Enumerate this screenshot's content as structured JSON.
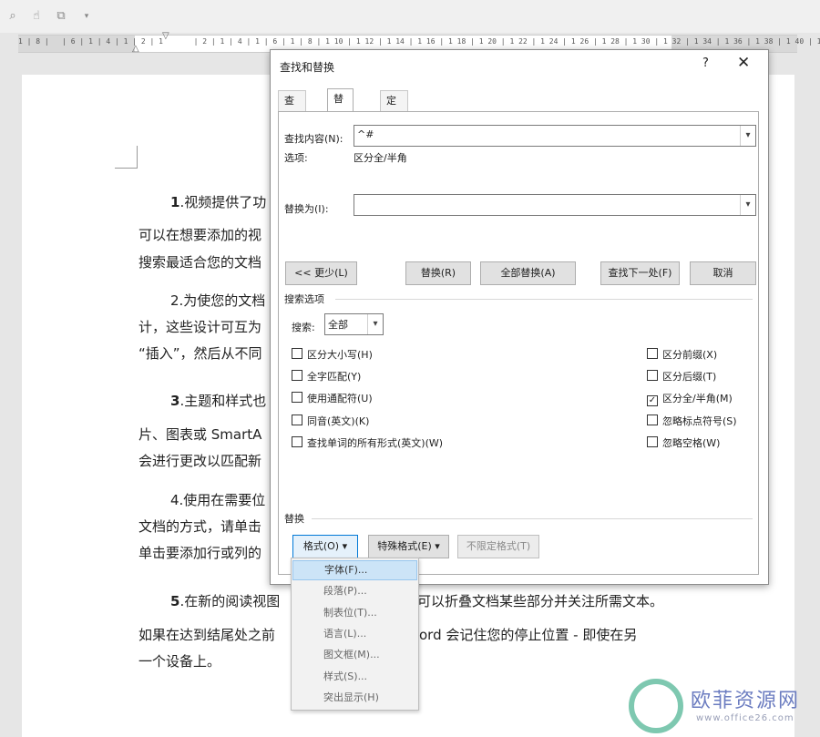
{
  "qat": {
    "icons": [
      "print-preview-icon",
      "touch-mode-icon",
      "screen-icon",
      "customize-dropdown-icon"
    ]
  },
  "ruler": {
    "numbers": "1 | 8 |   | 6 | 1 | 4 | 1 | 2 | 1       | 2 | 1 | 4 | 1 | 6 | 1 | 8 | 1 10 | 1 12 | 1 14 | 1 16 | 1 18 | 1 20 | 1 22 | 1 24 | 1 26 | 1 28 | 1 30 | 1 32 | 1 34 | 1 36 | 1 38 | 1 40 | 1 42"
  },
  "document": {
    "p1_num": "1",
    "p1_text": ".视频提供了功",
    "p1_line2": "可以在想要添加的视",
    "p1_line3": "搜索最适合您的文档",
    "p2_line1": "2.为使您的文档",
    "p2_line2": "计，这些设计可互为",
    "p2_line3": "“插入”，然后从不同",
    "p3_num": "3",
    "p3_text": ".主题和样式也",
    "p3_line2": "片、图表或 SmartA",
    "p3_line3": "会进行更改以匹配新",
    "p4_line1": "4.使用在需要位",
    "p4_line2": "文档的方式，请单击",
    "p4_line3": "单击要添加行或列的",
    "p5_num": "5",
    "p5_text": ".在新的阅读视图",
    "p5_tail": "可以折叠文档某些部分并关注所需文本。",
    "p5_line2a": "如果在达到结尾处之前",
    "p5_line2b": "ord  会记住您的停止位置  -  即使在另",
    "p5_line3": "一个设备上。"
  },
  "dialog": {
    "title": "查找和替换",
    "help": "?",
    "close": "✕",
    "tabs": [
      "查找(D)",
      "替换(P)",
      "定位(G)"
    ],
    "find_label": "查找内容(N):",
    "find_value": "^#",
    "options_label": "选项:",
    "options_value": "区分全/半角",
    "replace_label": "替换为(I):",
    "replace_value": "",
    "buttons": {
      "less": "<< 更少(L)",
      "replace": "替换(R)",
      "replace_all": "全部替换(A)",
      "find_next": "查找下一处(F)",
      "cancel": "取消"
    },
    "search_options_title": "搜索选项",
    "search_label": "搜索:",
    "search_value": "全部",
    "checkboxes_left": [
      {
        "label": "区分大小写(H)",
        "checked": false
      },
      {
        "label": "全字匹配(Y)",
        "checked": false
      },
      {
        "label": "使用通配符(U)",
        "checked": false
      },
      {
        "label": "同音(英文)(K)",
        "checked": false
      },
      {
        "label": "查找单词的所有形式(英文)(W)",
        "checked": false
      }
    ],
    "checkboxes_right": [
      {
        "label": "区分前缀(X)",
        "checked": false
      },
      {
        "label": "区分后缀(T)",
        "checked": false
      },
      {
        "label": "区分全/半角(M)",
        "checked": true
      },
      {
        "label": "忽略标点符号(S)",
        "checked": false
      },
      {
        "label": "忽略空格(W)",
        "checked": false
      }
    ],
    "replace_section_title": "替换",
    "format_button": "格式(O) ▾",
    "special_button": "特殊格式(E) ▾",
    "no_format_button": "不限定格式(T)"
  },
  "format_menu": {
    "items": [
      "字体(F)...",
      "段落(P)...",
      "制表位(T)...",
      "语言(L)...",
      "图文框(M)...",
      "样式(S)...",
      "突出显示(H)"
    ],
    "highlighted_index": 0
  },
  "watermark": {
    "name": "欧菲资源网",
    "url": "www.office26.com"
  }
}
